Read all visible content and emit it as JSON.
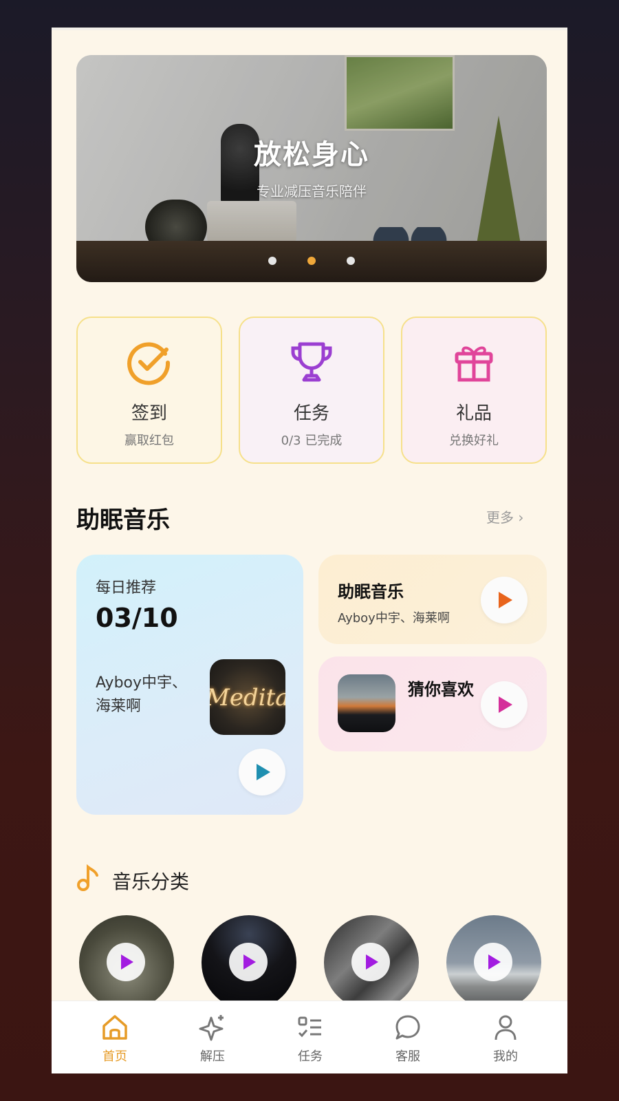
{
  "banner": {
    "title": "放松身心",
    "subtitle": "专业减压音乐陪伴",
    "dots": 3,
    "active_dot": 2
  },
  "actions": [
    {
      "title": "签到",
      "subtitle": "赢取红包",
      "icon": "check-circle-icon",
      "color": "#f0a02a"
    },
    {
      "title": "任务",
      "subtitle": "0/3 已完成",
      "icon": "trophy-icon",
      "color": "#9b3fd1"
    },
    {
      "title": "礼品",
      "subtitle": "兑换好礼",
      "icon": "gift-icon",
      "color": "#e0459a"
    }
  ],
  "section": {
    "title": "助眠音乐",
    "more": "更多 ›"
  },
  "daily": {
    "label": "每日推荐",
    "date": "03/10",
    "artist": "Ayboy中宇、海莱啊",
    "cover_text": "Meditation"
  },
  "card_a": {
    "title": "助眠音乐",
    "artist": "Ayboy中宇、海莱啊"
  },
  "card_b": {
    "title": "猜你喜欢"
  },
  "categories": {
    "title": "音乐分类",
    "icon": "music-note-icon",
    "items": [
      "forest",
      "night",
      "rock",
      "sea"
    ]
  },
  "tabs": [
    {
      "label": "首页",
      "icon": "home-icon",
      "active": true
    },
    {
      "label": "解压",
      "icon": "sparkle-icon",
      "active": false
    },
    {
      "label": "任务",
      "icon": "checklist-icon",
      "active": false
    },
    {
      "label": "客服",
      "icon": "chat-bubble-icon",
      "active": false
    },
    {
      "label": "我的",
      "icon": "user-icon",
      "active": false
    }
  ],
  "colors": {
    "accent": "#e69b27",
    "background": "#fdf6e9",
    "play_blue": "#1f8fb0",
    "play_orange": "#e8641c",
    "play_pink": "#d42f9a",
    "play_purple": "#a21ce0"
  }
}
